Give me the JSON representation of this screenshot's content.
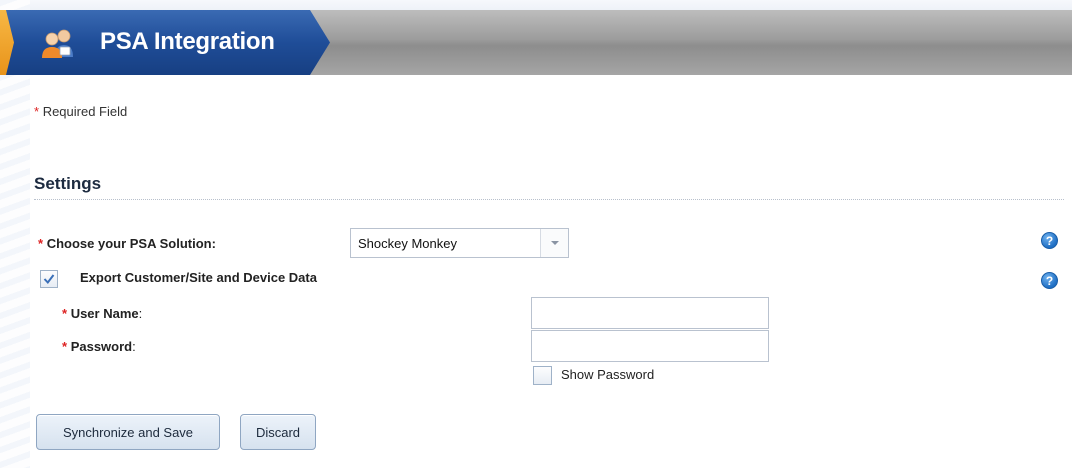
{
  "header": {
    "title": "PSA Integration",
    "icon": "users-group-icon"
  },
  "required_note": {
    "star": "*",
    "text": "Required Field"
  },
  "settings": {
    "title": "Settings",
    "psa_solution": {
      "label": "Choose your PSA Solution:",
      "selected_value": "Shockey Monkey"
    },
    "export": {
      "label": "Export Customer/Site and Device Data",
      "checked": true
    },
    "username": {
      "label": "User Name",
      "colon": ":",
      "value": ""
    },
    "password": {
      "label": "Password",
      "colon": ":",
      "value": ""
    },
    "show_password": {
      "label": "Show Password",
      "checked": false
    },
    "help_glyph": "?"
  },
  "buttons": {
    "sync_save": "Synchronize and Save",
    "discard": "Discard"
  },
  "colors": {
    "header_blue": "#1f4d98",
    "accent_orange": "#e8931a",
    "required_red": "#dd2222",
    "help_blue": "#1f6fc4"
  }
}
